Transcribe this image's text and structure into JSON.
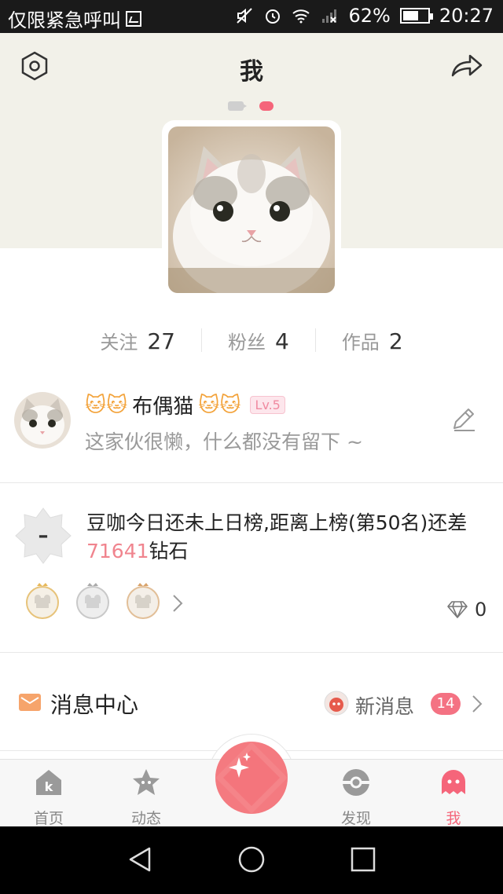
{
  "status_bar": {
    "carrier": "仅限紧急呼叫",
    "battery": "62%",
    "battery_level": 0.62,
    "time": "20:27"
  },
  "header": {
    "title": "我"
  },
  "stats": [
    {
      "label": "关注",
      "value": "27"
    },
    {
      "label": "粉丝",
      "value": "4"
    },
    {
      "label": "作品",
      "value": "2"
    }
  ],
  "profile": {
    "username_prefix": "🐱🐱",
    "username": "布偶猫",
    "username_suffix": "🐱🐱",
    "level": "Lv.5",
    "signature": "这家伙很懒，什么都没有留下 ~"
  },
  "rank": {
    "text_before": "豆咖今日还未上日榜,距离上榜(第50名)还差",
    "diamonds_needed": "71641",
    "text_after": "钻石",
    "badge_symbol": "–",
    "diamond_count": "0"
  },
  "messages": {
    "title": "消息中心",
    "new_label": "新消息",
    "new_count": "14"
  },
  "tabbar": {
    "tabs": [
      {
        "label": "首页",
        "icon": "home-k-icon"
      },
      {
        "label": "动态",
        "icon": "star-face-icon"
      },
      {
        "label": "发现",
        "icon": "pokeball-icon"
      },
      {
        "label": "我",
        "icon": "ghost-icon"
      }
    ],
    "active": "我"
  },
  "colors": {
    "accent": "#f5657a",
    "header_bg": "#f2f1e9",
    "highlight": "#f0848e"
  }
}
